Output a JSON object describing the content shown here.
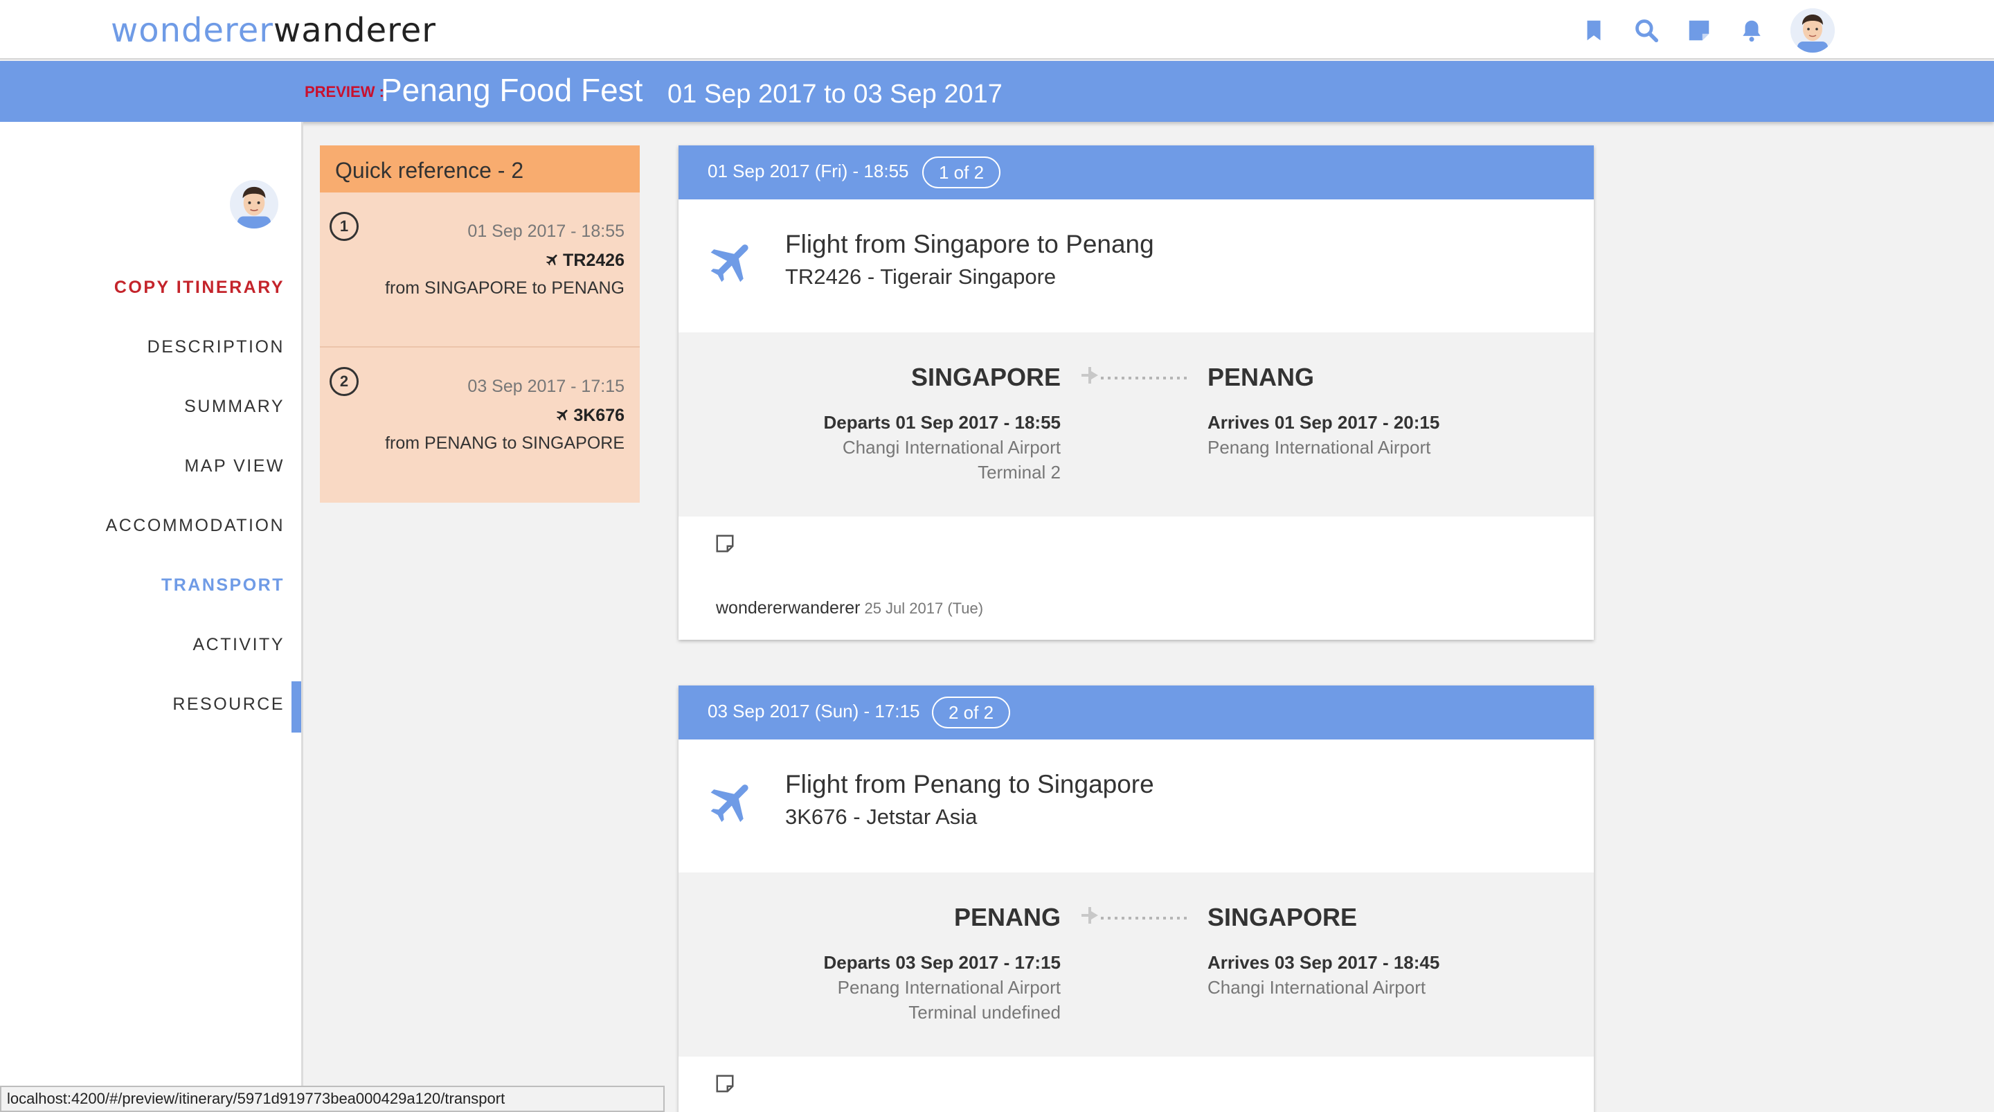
{
  "brand": {
    "logo_part1": "wonderer",
    "logo_part2": "wanderer"
  },
  "nav_icons": [
    "bookmark-icon",
    "search-icon",
    "note-icon",
    "bell-icon"
  ],
  "header": {
    "preview_label": "PREVIEW :",
    "title": "Penang Food Fest",
    "dates": "01 Sep 2017 to 03 Sep 2017"
  },
  "sidebar": {
    "items": [
      {
        "label": "COPY ITINERARY"
      },
      {
        "label": "DESCRIPTION"
      },
      {
        "label": "SUMMARY"
      },
      {
        "label": "MAP VIEW"
      },
      {
        "label": "ACCOMMODATION"
      },
      {
        "label": "TRANSPORT"
      },
      {
        "label": "ACTIVITY"
      },
      {
        "label": "RESOURCE"
      }
    ],
    "active": "TRANSPORT"
  },
  "quickref": {
    "title": "Quick reference - 2",
    "items": [
      {
        "num": "1",
        "date": "01 Sep 2017 - 18:55",
        "flight": "TR2426",
        "route": "from SINGAPORE to PENANG"
      },
      {
        "num": "2",
        "date": "03 Sep 2017 - 17:15",
        "flight": "3K676",
        "route": "from PENANG to SINGAPORE"
      }
    ]
  },
  "transports": [
    {
      "datetime": "01 Sep 2017 (Fri) - 18:55",
      "count": "1 of 2",
      "title": "Flight from Singapore to Penang",
      "subtitle": "TR2426 - Tigerair Singapore",
      "from_city": "SINGAPORE",
      "to_city": "PENANG",
      "departs": "Departs 01 Sep 2017 - 18:55",
      "departs_airport": "Changi International Airport",
      "departs_terminal": "Terminal 2",
      "arrives": "Arrives 01 Sep 2017 - 20:15",
      "arrives_airport": "Penang International Airport",
      "author": "wondererwanderer",
      "author_date": "25 Jul 2017 (Tue)"
    },
    {
      "datetime": "03 Sep 2017 (Sun) - 17:15",
      "count": "2 of 2",
      "title": "Flight from Penang to Singapore",
      "subtitle": "3K676 - Jetstar Asia",
      "from_city": "PENANG",
      "to_city": "SINGAPORE",
      "departs": "Departs 03 Sep 2017 - 17:15",
      "departs_airport": "Penang International Airport",
      "departs_terminal": "Terminal undefined",
      "arrives": "Arrives 03 Sep 2017 - 18:45",
      "arrives_airport": "Changi International Airport"
    }
  ],
  "statusbar": {
    "url": "localhost:4200/#/preview/itinerary/5971d919773bea000429a120/transport"
  },
  "colors": {
    "accent": "#6f9be6",
    "quickref_head": "#f8ac6f",
    "quickref_body": "#f9d9c4",
    "copy_link": "#c4242b"
  }
}
